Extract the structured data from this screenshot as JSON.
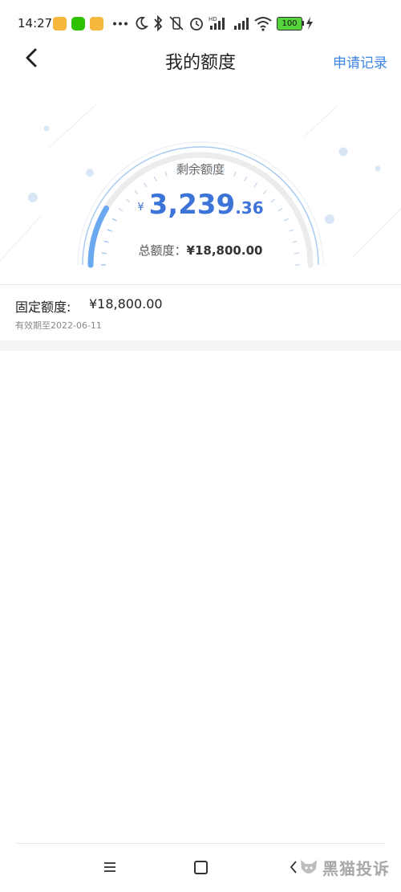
{
  "status_bar": {
    "time": "14:27",
    "battery": "100",
    "colors": {
      "notif1": "#f5a623",
      "wechat": "#2dc100",
      "notif2": "#f5a623"
    }
  },
  "nav": {
    "title": "我的额度",
    "apply_record": "申请记录"
  },
  "gauge": {
    "label": "剩余额度",
    "currency": "¥",
    "amount_int": "3,239",
    "amount_dec": ".36",
    "total_label": "总额度：",
    "total_value": "¥18,800.00",
    "remaining_fraction": 0.172,
    "accent": "#3d74d8"
  },
  "fixed": {
    "label": "固定额度:",
    "value": "¥18,800.00",
    "valid_until": "有效期至2022-06-11"
  },
  "watermark": {
    "text": "黑猫投诉"
  }
}
